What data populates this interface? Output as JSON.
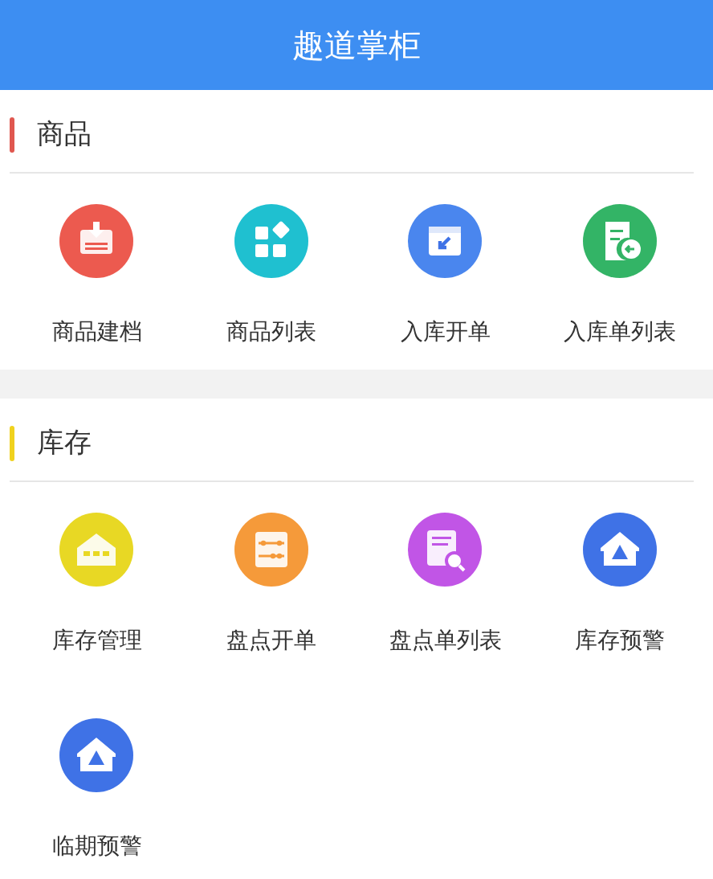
{
  "header": {
    "title": "趣道掌柜"
  },
  "sections": [
    {
      "title": "商品",
      "color": "#e0574f",
      "items": [
        {
          "label": "商品建档",
          "kind": "archive",
          "color": "#ec5a4f"
        },
        {
          "label": "商品列表",
          "kind": "grid",
          "color": "#1fc0d0"
        },
        {
          "label": "入库开单",
          "kind": "inbox",
          "color": "#4a86ee"
        },
        {
          "label": "入库单列表",
          "kind": "doclist",
          "color": "#33b466"
        }
      ]
    },
    {
      "title": "库存",
      "color": "#f0d21e",
      "items": [
        {
          "label": "库存管理",
          "kind": "warehouse",
          "color": "#e8d824"
        },
        {
          "label": "盘点开单",
          "kind": "abacus",
          "color": "#f59a3a"
        },
        {
          "label": "盘点单列表",
          "kind": "docsearch",
          "color": "#c155e6"
        },
        {
          "label": "库存预警",
          "kind": "alert",
          "color": "#3f72e6"
        },
        {
          "label": "临期预警",
          "kind": "alert",
          "color": "#3f72e6"
        }
      ]
    }
  ]
}
